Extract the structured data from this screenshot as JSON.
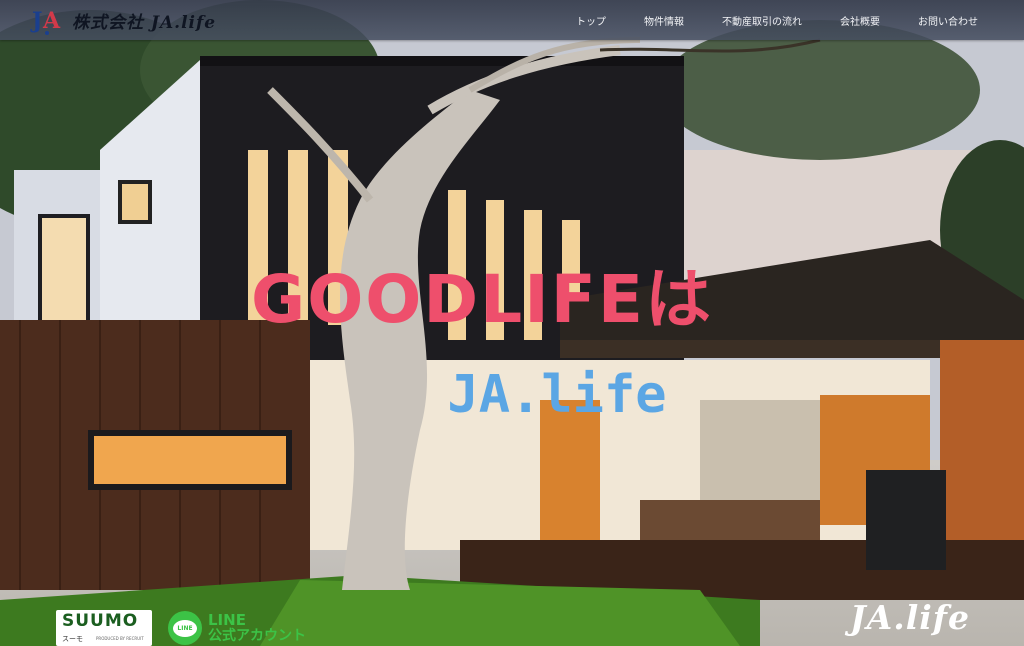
{
  "header": {
    "logo_text": "株式会社 JA.life",
    "logo_icon": "ja-monogram-icon",
    "nav": [
      "トップ",
      "物件情報",
      "不動産取引の流れ",
      "会社概要",
      "お問い合わせ"
    ]
  },
  "hero": {
    "headline": "GOODLIFEは",
    "subheadline": "JA.life",
    "image": "modern-house-photo"
  },
  "badges": {
    "suumo_word": "SUUMO",
    "suumo_kana": "スーモ",
    "suumo_by": "PRODUCED BY RECRUIT",
    "line_icon_text": "LINE",
    "line_title": "LINE",
    "line_subtitle": "公式アカウント"
  },
  "footer": {
    "logo_text": "JA.life"
  },
  "colors": {
    "headline": "#ee4f6c",
    "subheadline": "#5ba6e4",
    "line_green": "#3cc346",
    "topbar": "#3a4050"
  }
}
